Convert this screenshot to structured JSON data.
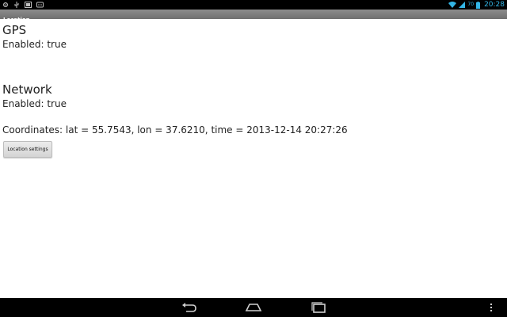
{
  "status_bar": {
    "left_icons": [
      "settings-icon",
      "usb-icon",
      "notification-icon",
      "android-debug-icon"
    ],
    "right_icons": [
      "wifi-icon",
      "signal-icon",
      "battery-icon"
    ],
    "battery_level": "70",
    "time": "20:28",
    "accent_color": "#33b5e5"
  },
  "title_bar": {
    "title": "Location"
  },
  "gps": {
    "heading": "GPS",
    "status": "Enabled: true"
  },
  "network": {
    "heading": "Network",
    "status": "Enabled: true"
  },
  "coordinates": {
    "text": "Coordinates: lat = 55.7543, lon = 37.6210, time = 2013-12-14 20:27:26"
  },
  "location_settings_button": {
    "label": "Location settings"
  },
  "nav_bar": {
    "buttons": [
      "back-icon",
      "home-icon",
      "recent-apps-icon",
      "overflow-menu-icon"
    ]
  }
}
